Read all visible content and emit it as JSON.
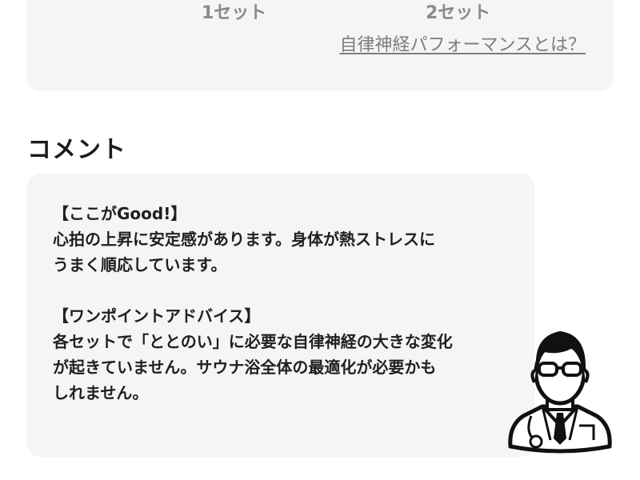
{
  "top_card": {
    "set1_label": "1セット",
    "set2_label": "2セット",
    "anp_link": "自律神経パフォーマンスとは？"
  },
  "comment_section": {
    "heading": "コメント",
    "good_title": "【ここがGood!】",
    "good_line1": "心拍の上昇に安定感があります。身体が熱ストレスに",
    "good_line2": "うまく順応しています。",
    "advice_title": "【ワンポイントアドバイス】",
    "advice_line1": "各セットで「ととのい」に必要な自律神経の大きな変化",
    "advice_line2": "が起きていません。サウナ浴全体の最適化が必要かも",
    "advice_line3": "しれません。"
  },
  "icons": {
    "doctor": "doctor-avatar-icon"
  }
}
